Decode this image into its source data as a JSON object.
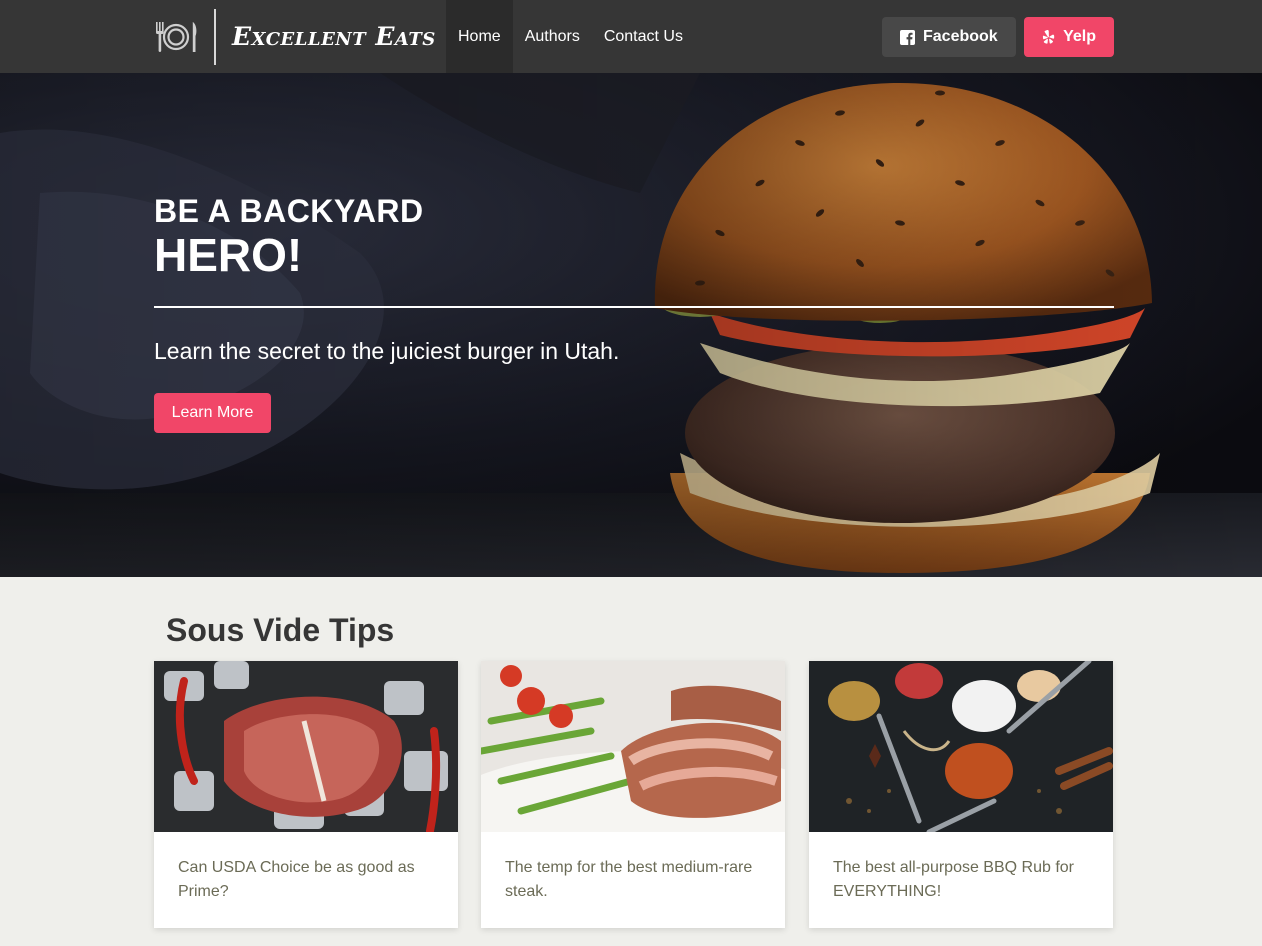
{
  "brand": {
    "name": "Excellent Eats",
    "icon": "plate-fork-knife-icon"
  },
  "nav": {
    "links": [
      {
        "label": "Home",
        "active": true
      },
      {
        "label": "Authors",
        "active": false
      },
      {
        "label": "Contact Us",
        "active": false
      }
    ],
    "facebook_label": "Facebook",
    "yelp_label": "Yelp"
  },
  "hero": {
    "subtitle": "BE A BACKYARD",
    "title": "HERO!",
    "tagline": "Learn the secret to the juiciest burger in Utah.",
    "button_label": "Learn More",
    "image": "burger-photo"
  },
  "section": {
    "title": "Sous Vide Tips",
    "cards": [
      {
        "text": "Can USDA Choice be as good as Prime?",
        "image": "t-bone-steak-on-ice-photo"
      },
      {
        "text": "The temp for the best medium-rare steak.",
        "image": "sliced-steak-with-asparagus-photo"
      },
      {
        "text": "The best all-purpose BBQ Rub for EVERYTHING!",
        "image": "spices-in-spoons-photo"
      }
    ]
  },
  "colors": {
    "navbar": "#363636",
    "accent_pink": "#f14668",
    "facebook_button": "#484848",
    "page_background": "#efefeb",
    "card_text": "#6b6b56"
  }
}
